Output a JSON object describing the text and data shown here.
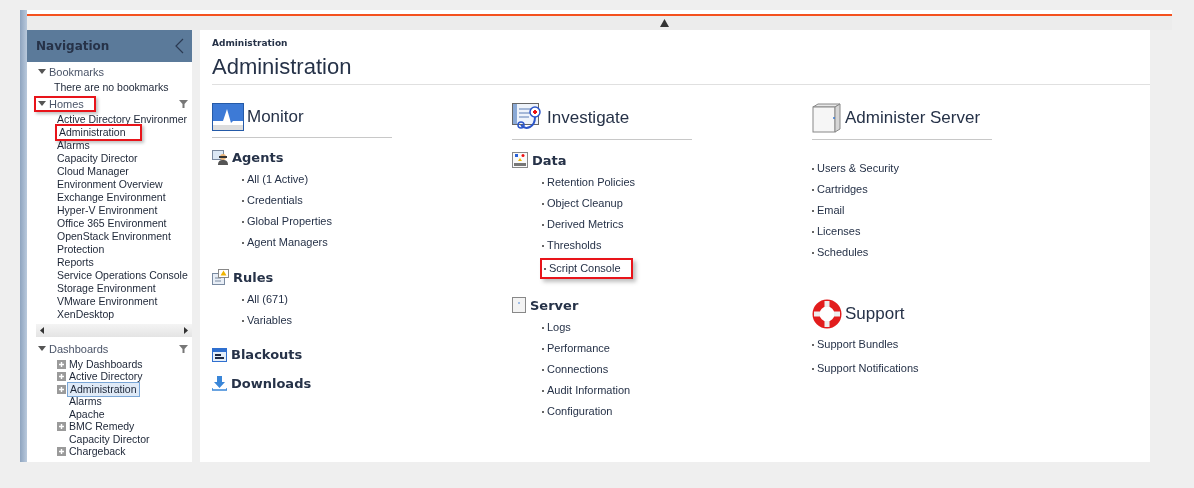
{
  "navigation": {
    "title": "Navigation",
    "sections": [
      {
        "title": "Bookmarks",
        "expanded": true,
        "highlighted": false,
        "filter": false,
        "empty_text": "There are no bookmarks"
      },
      {
        "title": "Homes",
        "expanded": true,
        "highlighted": true,
        "filter": true,
        "items": [
          {
            "label": "Active Directory Environmer",
            "highlighted": false
          },
          {
            "label": "Administration",
            "highlighted": true
          },
          {
            "label": "Alarms",
            "highlighted": false
          },
          {
            "label": "Capacity Director",
            "highlighted": false
          },
          {
            "label": "Cloud Manager",
            "highlighted": false
          },
          {
            "label": "Environment Overview",
            "highlighted": false
          },
          {
            "label": "Exchange Environment",
            "highlighted": false
          },
          {
            "label": "Hyper-V Environment",
            "highlighted": false
          },
          {
            "label": "Office 365 Environment",
            "highlighted": false
          },
          {
            "label": "OpenStack Environment",
            "highlighted": false
          },
          {
            "label": "Protection",
            "highlighted": false
          },
          {
            "label": "Reports",
            "highlighted": false
          },
          {
            "label": "Service Operations Console",
            "highlighted": false
          },
          {
            "label": "Storage Environment",
            "highlighted": false
          },
          {
            "label": "VMware Environment",
            "highlighted": false
          },
          {
            "label": "XenDesktop",
            "highlighted": false
          }
        ]
      },
      {
        "title": "Dashboards",
        "expanded": true,
        "highlighted": false,
        "filter": true,
        "items": [
          {
            "label": "My Dashboards",
            "expandable": true,
            "selected": false
          },
          {
            "label": "Active Directory",
            "expandable": true,
            "selected": false
          },
          {
            "label": "Administration",
            "expandable": true,
            "selected": true
          },
          {
            "label": "Alarms",
            "expandable": false,
            "selected": false
          },
          {
            "label": "Apache",
            "expandable": false,
            "selected": false
          },
          {
            "label": "BMC Remedy",
            "expandable": true,
            "selected": false
          },
          {
            "label": "Capacity Director",
            "expandable": false,
            "selected": false
          },
          {
            "label": "Chargeback",
            "expandable": true,
            "selected": false
          }
        ]
      }
    ]
  },
  "breadcrumb": "Administration",
  "title": "Administration",
  "columns": [
    {
      "sections": [
        {
          "kind": "heading",
          "title": "Monitor"
        },
        {
          "kind": "group",
          "title": "Agents",
          "links": [
            {
              "label": "All (1 Active)",
              "highlighted": false
            },
            {
              "label": "Credentials",
              "highlighted": false
            },
            {
              "label": "Global Properties",
              "highlighted": false
            },
            {
              "label": "Agent Managers",
              "highlighted": false
            }
          ]
        },
        {
          "kind": "group",
          "title": "Rules",
          "links": [
            {
              "label": "All  (671)",
              "highlighted": false
            },
            {
              "label": "Variables",
              "highlighted": false
            }
          ]
        },
        {
          "kind": "group",
          "title": "Blackouts"
        },
        {
          "kind": "group",
          "title": "Downloads"
        }
      ]
    },
    {
      "sections": [
        {
          "kind": "heading",
          "title": "Investigate"
        },
        {
          "kind": "group",
          "title": "Data",
          "links": [
            {
              "label": "Retention Policies",
              "highlighted": false
            },
            {
              "label": "Object Cleanup",
              "highlighted": false
            },
            {
              "label": "Derived Metrics",
              "highlighted": false
            },
            {
              "label": "Thresholds",
              "highlighted": false
            },
            {
              "label": "Script Console",
              "highlighted": true
            }
          ]
        },
        {
          "kind": "group",
          "title": "Server",
          "links": [
            {
              "label": "Logs",
              "highlighted": false
            },
            {
              "label": "Performance",
              "highlighted": false
            },
            {
              "label": "Connections",
              "highlighted": false
            },
            {
              "label": "Audit Information",
              "highlighted": false
            },
            {
              "label": "Configuration",
              "highlighted": false
            }
          ]
        }
      ]
    },
    {
      "sections": [
        {
          "kind": "heading",
          "title": "Administer Server",
          "links": [
            {
              "label": "Users & Security",
              "highlighted": false
            },
            {
              "label": "Cartridges",
              "highlighted": false
            },
            {
              "label": "Email",
              "highlighted": false
            },
            {
              "label": "Licenses",
              "highlighted": false
            },
            {
              "label": "Schedules",
              "highlighted": false
            }
          ]
        },
        {
          "kind": "plain-heading",
          "title": "Support",
          "links": [
            {
              "label": "Support Bundles",
              "highlighted": false
            },
            {
              "label": "Support Notifications",
              "highlighted": false
            }
          ]
        }
      ]
    }
  ]
}
